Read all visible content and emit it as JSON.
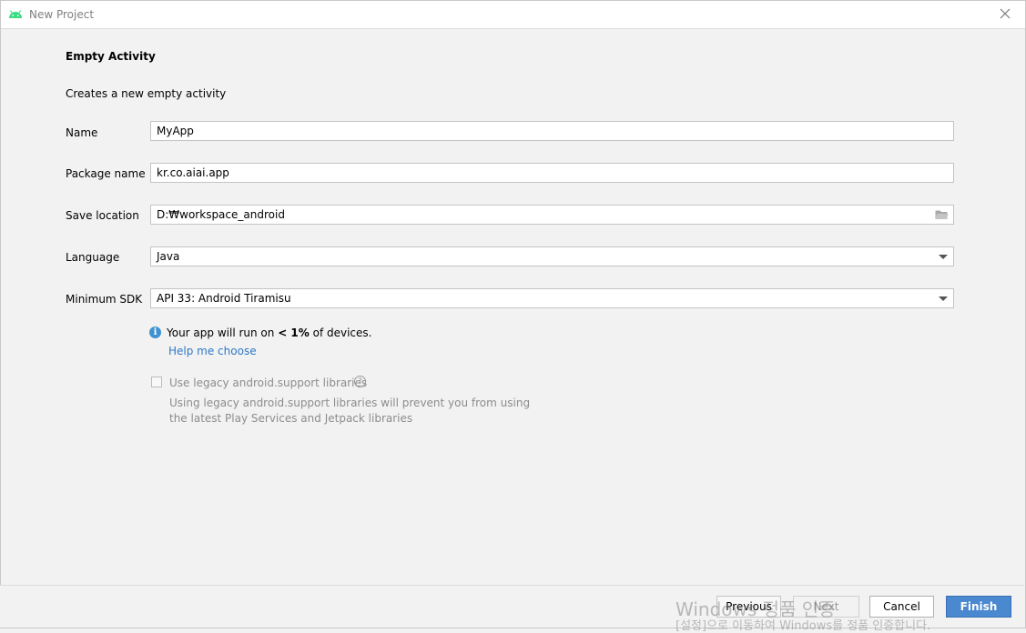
{
  "window": {
    "title": "New Project",
    "app_icon": "android-icon",
    "close_icon": "close-icon"
  },
  "content": {
    "heading": "Empty Activity",
    "description": "Creates a new empty activity"
  },
  "form": {
    "name": {
      "label": "Name",
      "value": "MyApp"
    },
    "package_name": {
      "label": "Package name",
      "value": "kr.co.aiai.app"
    },
    "save_location": {
      "label": "Save location",
      "value": "D:₩workspace_android",
      "icon": "folder-icon"
    },
    "language": {
      "label": "Language",
      "value": "Java"
    },
    "minimum_sdk": {
      "label": "Minimum SDK",
      "value": "API 33: Android Tiramisu"
    }
  },
  "info": {
    "icon": "info-icon",
    "text_before": "Your app will run on ",
    "text_strong_prefix": "< ",
    "text_strong": "1%",
    "text_after": " of devices.",
    "help_link": "Help me choose"
  },
  "legacy": {
    "checkbox_label": "Use legacy android.support libraries",
    "checked": false,
    "note_line1": "Using legacy android.support libraries will prevent you from using",
    "note_line2": "the latest Play Services and Jetpack libraries"
  },
  "buttons": {
    "previous": "Previous",
    "next": "Next",
    "cancel": "Cancel",
    "finish": "Finish"
  },
  "watermark": {
    "line1": "Windows 정품 인증",
    "line2": "[설정]으로 이동하여 Windows를 정품 인증합니다."
  },
  "colors": {
    "accent": "#4a88d0",
    "link": "#2e78c4",
    "info": "#3f92cf",
    "android_green": "#3ddc84"
  }
}
